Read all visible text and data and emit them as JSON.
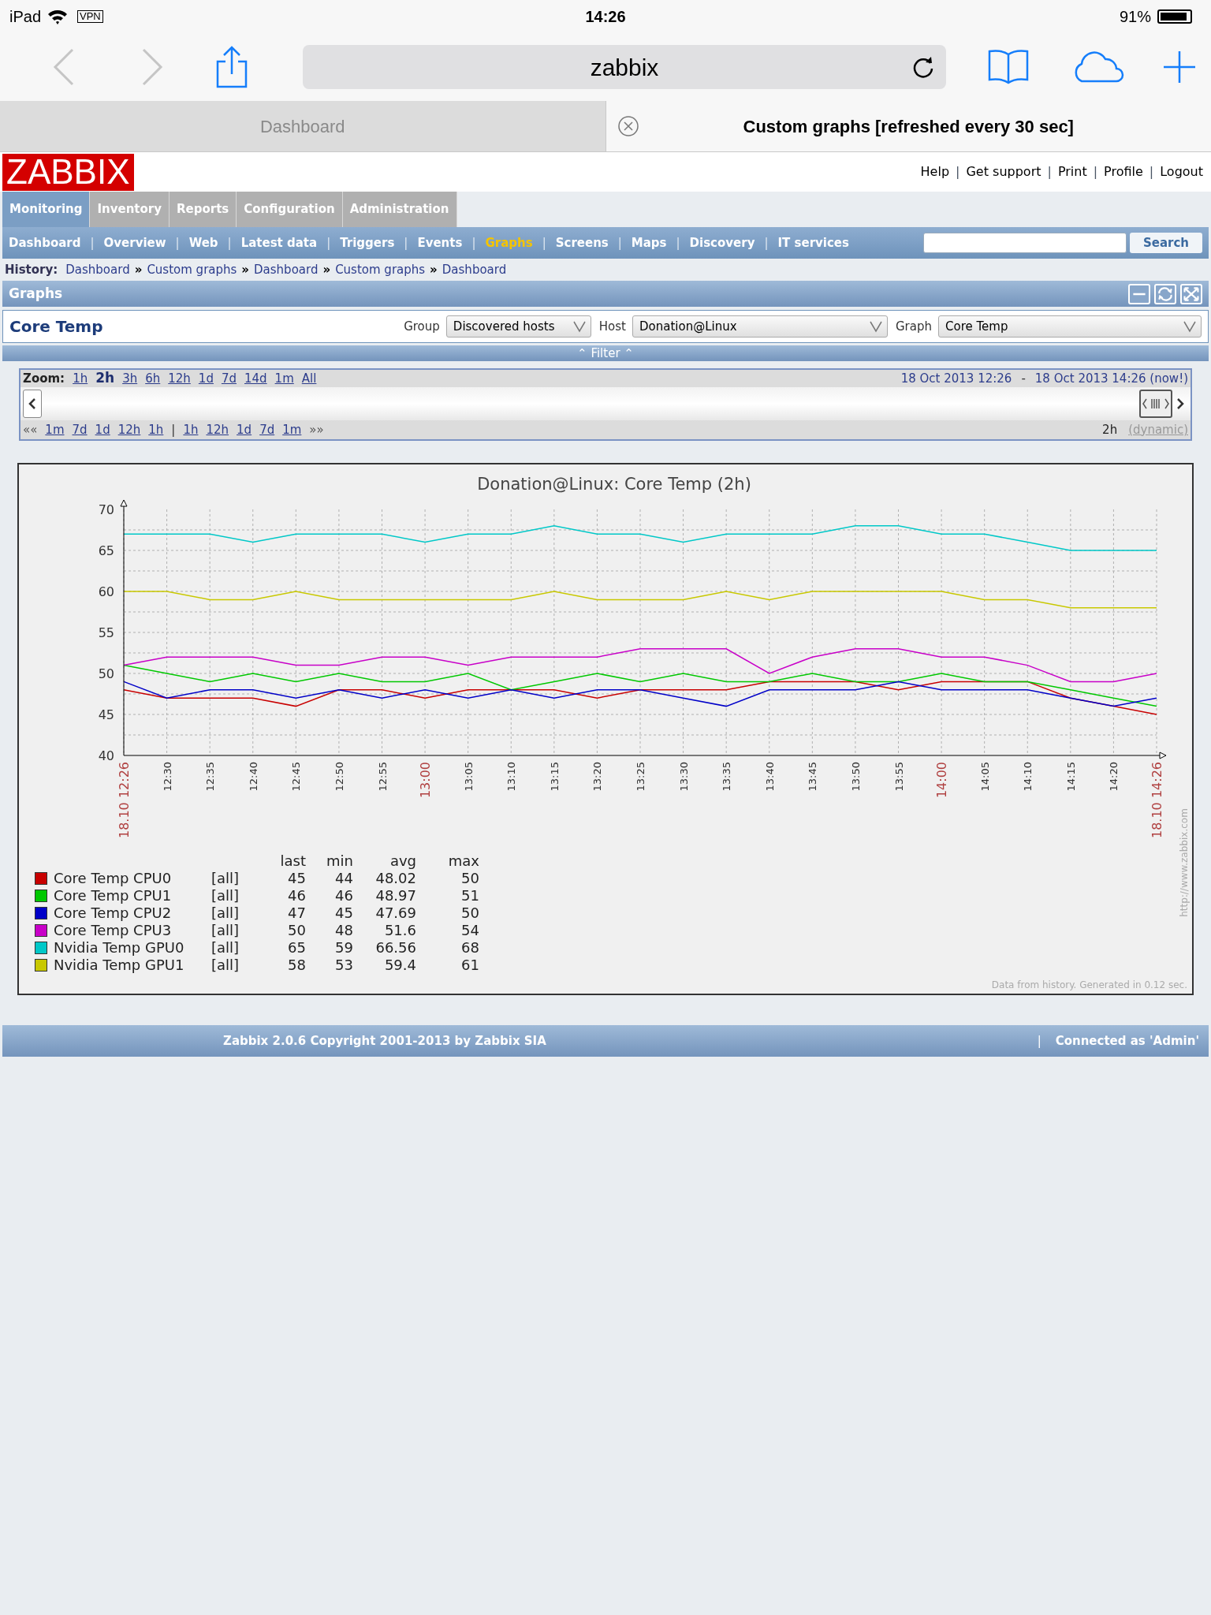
{
  "status_bar": {
    "device": "iPad",
    "vpn": "VPN",
    "time": "14:26",
    "battery": "91%",
    "battery_icon": {
      "level": 0.91
    }
  },
  "browser": {
    "url": "zabbix",
    "back_disabled": true,
    "forward_disabled": true
  },
  "browser_tabs": [
    {
      "label": "Dashboard",
      "selected": false
    },
    {
      "label": "Custom graphs [refreshed every 30 sec]",
      "selected": true
    }
  ],
  "logo": "ZABBIX",
  "top_links": [
    "Help",
    "Get support",
    "Print",
    "Profile",
    "Logout"
  ],
  "main_menu": [
    {
      "label": "Monitoring",
      "selected": true
    },
    {
      "label": "Inventory",
      "selected": false
    },
    {
      "label": "Reports",
      "selected": false
    },
    {
      "label": "Configuration",
      "selected": false
    },
    {
      "label": "Administration",
      "selected": false
    }
  ],
  "sub_menu": [
    {
      "label": "Dashboard",
      "selected": false
    },
    {
      "label": "Overview",
      "selected": false
    },
    {
      "label": "Web",
      "selected": false
    },
    {
      "label": "Latest data",
      "selected": false
    },
    {
      "label": "Triggers",
      "selected": false
    },
    {
      "label": "Events",
      "selected": false
    },
    {
      "label": "Graphs",
      "selected": true
    },
    {
      "label": "Screens",
      "selected": false
    },
    {
      "label": "Maps",
      "selected": false
    },
    {
      "label": "Discovery",
      "selected": false
    },
    {
      "label": "IT services",
      "selected": false
    }
  ],
  "search_button": "Search",
  "history": {
    "label": "History:",
    "separator": "»",
    "items": [
      "Dashboard",
      "Custom graphs",
      "Dashboard",
      "Custom graphs",
      "Dashboard"
    ]
  },
  "section_title": "Graphs",
  "graph_title": "Core Temp",
  "filters": [
    {
      "label": "Group",
      "value": "Discovered hosts"
    },
    {
      "label": "Host",
      "value": "Donation@Linux"
    },
    {
      "label": "Graph",
      "value": "Core Temp"
    }
  ],
  "filter_bar": "⌃ Filter ⌃",
  "zoom": {
    "label": "Zoom:",
    "periods": [
      {
        "label": "1h",
        "selected": false
      },
      {
        "label": "2h",
        "selected": true
      },
      {
        "label": "3h",
        "selected": false
      },
      {
        "label": "6h",
        "selected": false
      },
      {
        "label": "12h",
        "selected": false
      },
      {
        "label": "1d",
        "selected": false
      },
      {
        "label": "7d",
        "selected": false
      },
      {
        "label": "14d",
        "selected": false
      },
      {
        "label": "1m",
        "selected": false
      },
      {
        "label": "All",
        "selected": false
      }
    ],
    "range_start": "18 Oct 2013 12:26",
    "range_separator": "-",
    "range_end": "18 Oct 2013 14:26 (now!)",
    "back_all": "««",
    "back_links": [
      "1m",
      "7d",
      "1d",
      "12h",
      "1h"
    ],
    "separator": "|",
    "forward_links": [
      "1h",
      "12h",
      "1d",
      "7d",
      "1m"
    ],
    "forward_all": "»»",
    "period": "2h",
    "period_mode": "(dynamic)"
  },
  "graph": {
    "chart_data": {
      "type": "line",
      "title": "Donation@Linux: Core Temp (2h)",
      "categories": [
        "18.10 12:26",
        "12:30",
        "12:35",
        "12:40",
        "12:45",
        "12:50",
        "12:55",
        "13:00",
        "13:05",
        "13:10",
        "13:15",
        "13:20",
        "13:25",
        "13:30",
        "13:35",
        "13:40",
        "13:45",
        "13:50",
        "13:55",
        "14:00",
        "14:05",
        "14:10",
        "14:15",
        "14:20",
        "18.10 14:26"
      ],
      "series": [
        {
          "name": "Core Temp CPU0",
          "color": "#c80000",
          "values": [
            48,
            47,
            47,
            47,
            46,
            48,
            48,
            47,
            48,
            48,
            48,
            47,
            48,
            48,
            48,
            49,
            49,
            49,
            48,
            49,
            49,
            49,
            47,
            46,
            45
          ]
        },
        {
          "name": "Core Temp CPU1",
          "color": "#00c800",
          "values": [
            51,
            50,
            49,
            50,
            49,
            50,
            49,
            49,
            50,
            48,
            49,
            50,
            49,
            50,
            49,
            49,
            50,
            49,
            49,
            50,
            49,
            49,
            48,
            47,
            46
          ]
        },
        {
          "name": "Core Temp CPU2",
          "color": "#0000c8",
          "values": [
            49,
            47,
            48,
            48,
            47,
            48,
            47,
            48,
            47,
            48,
            47,
            48,
            48,
            47,
            46,
            48,
            48,
            48,
            49,
            48,
            48,
            48,
            47,
            46,
            47
          ]
        },
        {
          "name": "Core Temp CPU3",
          "color": "#c800c8",
          "values": [
            51,
            52,
            52,
            52,
            51,
            51,
            52,
            52,
            51,
            52,
            52,
            52,
            53,
            53,
            53,
            50,
            52,
            53,
            53,
            52,
            52,
            51,
            49,
            49,
            50
          ]
        },
        {
          "name": "Nvidia Temp GPU0",
          "color": "#00c8c8",
          "values": [
            67,
            67,
            67,
            66,
            67,
            67,
            67,
            66,
            67,
            67,
            68,
            67,
            67,
            66,
            67,
            67,
            67,
            68,
            68,
            67,
            67,
            66,
            65,
            65,
            65
          ]
        },
        {
          "name": "Nvidia Temp GPU1",
          "color": "#c8c800",
          "values": [
            60,
            60,
            59,
            59,
            60,
            59,
            59,
            59,
            59,
            59,
            60,
            59,
            59,
            59,
            60,
            59,
            60,
            60,
            60,
            60,
            59,
            59,
            58,
            58,
            58
          ]
        }
      ],
      "grid": true,
      "ylim": [
        40,
        70
      ],
      "yticks": [
        40,
        45,
        50,
        55,
        60,
        65,
        70
      ]
    },
    "legend_headers": [
      "last",
      "min",
      "avg",
      "max"
    ],
    "legend": [
      {
        "function": "[all]",
        "last": "45",
        "min": "44",
        "avg": "48.02",
        "max": "50"
      },
      {
        "function": "[all]",
        "last": "46",
        "min": "46",
        "avg": "48.97",
        "max": "51"
      },
      {
        "function": "[all]",
        "last": "47",
        "min": "45",
        "avg": "47.69",
        "max": "50"
      },
      {
        "function": "[all]",
        "last": "50",
        "min": "48",
        "avg": "51.6",
        "max": "54"
      },
      {
        "function": "[all]",
        "last": "65",
        "min": "59",
        "avg": "66.56",
        "max": "68"
      },
      {
        "function": "[all]",
        "last": "58",
        "min": "53",
        "avg": "59.4",
        "max": "61"
      }
    ],
    "side_url": "http://www.zabbix.com",
    "generated": "Data from history. Generated in 0.12 sec."
  },
  "footer": {
    "copyright": "Zabbix 2.0.6 Copyright 2001-2013 by Zabbix SIA",
    "separator": "|",
    "connected": "Connected as 'Admin'"
  }
}
